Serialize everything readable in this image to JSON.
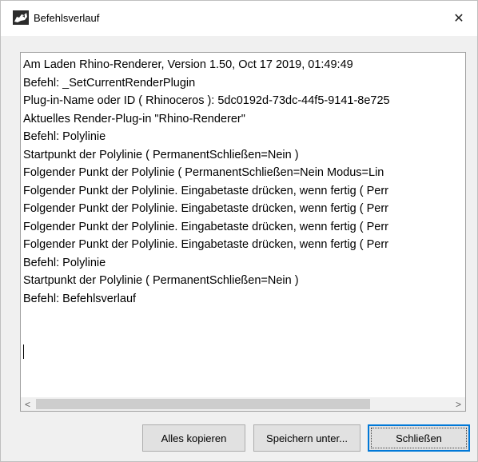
{
  "window": {
    "title": "Befehlsverlauf",
    "close_glyph": "✕"
  },
  "log": {
    "lines": [
      "Am Laden Rhino-Renderer, Version 1.50, Oct 17 2019, 01:49:49",
      "Befehl: _SetCurrentRenderPlugin",
      "Plug-in-Name oder ID ( Rhinoceros ): 5dc0192d-73dc-44f5-9141-8e725",
      "Aktuelles Render-Plug-in \"Rhino-Renderer\"",
      "Befehl: Polylinie",
      "Startpunkt der Polylinie ( PermanentSchließen=Nein )",
      "Folgender Punkt der Polylinie ( PermanentSchließen=Nein  Modus=Lin",
      "Folgender Punkt der Polylinie. Eingabetaste drücken, wenn fertig ( Perr",
      "Folgender Punkt der Polylinie. Eingabetaste drücken, wenn fertig ( Perr",
      "Folgender Punkt der Polylinie. Eingabetaste drücken, wenn fertig ( Perr",
      "Folgender Punkt der Polylinie. Eingabetaste drücken, wenn fertig ( Perr",
      "Befehl: Polylinie",
      "Startpunkt der Polylinie ( PermanentSchließen=Nein )",
      "Befehl: Befehlsverlauf"
    ]
  },
  "scrollbar": {
    "left_glyph": "<",
    "right_glyph": ">"
  },
  "buttons": {
    "copy_label": "Alles kopieren",
    "save_label": "Speichern unter...",
    "close_label": "Schließen"
  },
  "colors": {
    "focus_border": "#0078d7",
    "button_face": "#e1e1e1",
    "dialog_bg": "#f0f0f0"
  }
}
